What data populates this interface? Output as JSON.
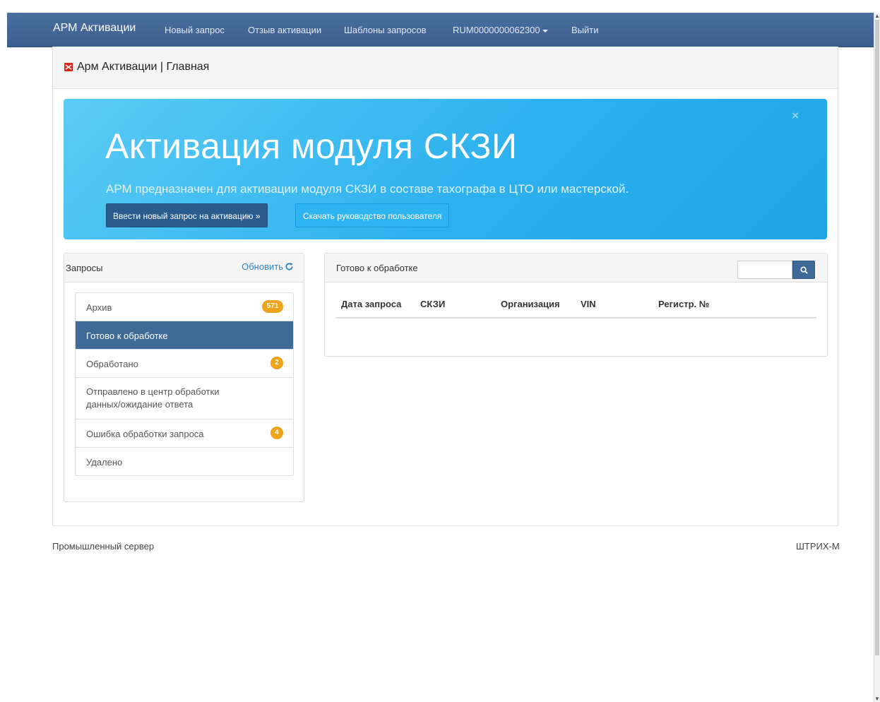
{
  "navbar": {
    "brand": "АРМ Активации",
    "links": [
      "Новый запрос",
      "Отзыв активации",
      "Шаблоны запросов",
      "RUM0000000062300",
      "Выйти"
    ]
  },
  "header": {
    "title": "Арм Активации | Главная"
  },
  "jumbotron": {
    "close": "×",
    "title": "Активация модуля СКЗИ",
    "subtitle": "АРМ предназначен для активации модуля СКЗИ в составе тахографа в ЦТО или мастерской.",
    "btn_new": "Ввести новый запрос на активацию »",
    "btn_download": "Скачать руководство пользователя"
  },
  "requests_panel": {
    "title": "Запросы",
    "refresh": "Обновить",
    "items": [
      {
        "label": "Архив",
        "badge": "571"
      },
      {
        "label": "Готово к обработке",
        "badge": ""
      },
      {
        "label": "Обработано",
        "badge": "2"
      },
      {
        "label": "Отправлено в центр обработки данных/ожидание ответа",
        "badge": ""
      },
      {
        "label": "Ошибка обработки запроса",
        "badge": "4"
      },
      {
        "label": "Удалено",
        "badge": ""
      }
    ]
  },
  "ready_panel": {
    "title": "Готово к обработке",
    "search_value": "",
    "columns": [
      "Дата запроса",
      "СКЗИ",
      "Организация",
      "VIN",
      "Регистр. №"
    ]
  },
  "footer": {
    "left": "Промышленный сервер",
    "right": "ШТРИХ-М"
  },
  "colors": {
    "navbar": "#3f6293",
    "active_item": "#3e6a97",
    "badge": "#f0a21a",
    "jumbotron": "#2db1ee",
    "link": "#2b86c8"
  }
}
